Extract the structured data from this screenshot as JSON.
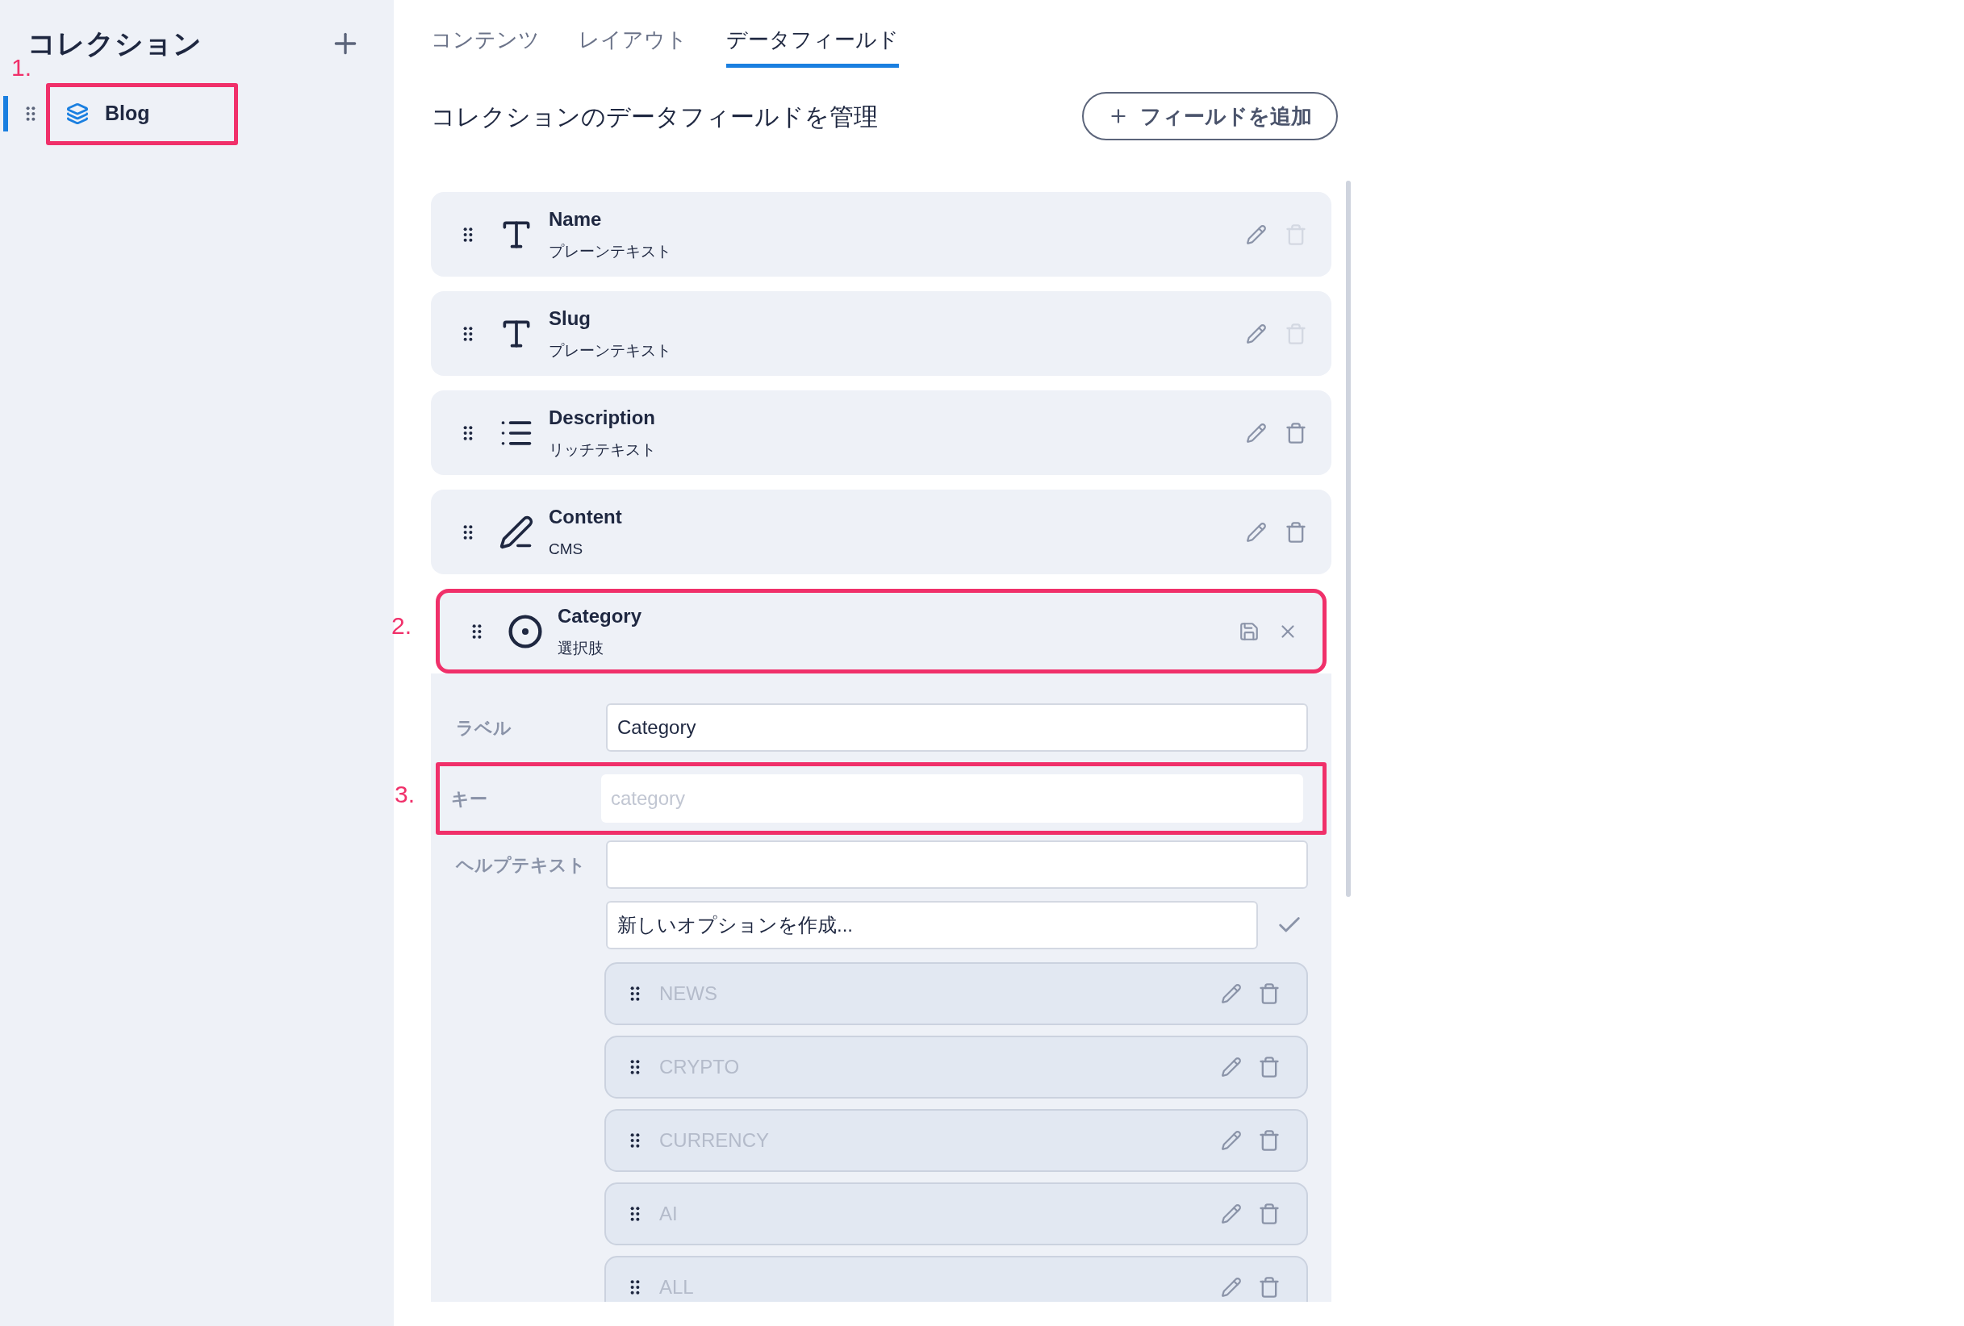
{
  "sidebar": {
    "title": "コレクション",
    "items": [
      {
        "label": "Blog",
        "selected": true,
        "annotation": "1."
      }
    ]
  },
  "tabs": [
    {
      "label": "コンテンツ",
      "selected": false
    },
    {
      "label": "レイアウト",
      "selected": false
    },
    {
      "label": "データフィールド",
      "selected": true
    }
  ],
  "heading": "コレクションのデータフィールドを管理",
  "add_button": "フィールドを追加",
  "fields": [
    {
      "name": "Name",
      "type": "プレーンテキスト",
      "kind": "text",
      "deletable": false,
      "editing": false
    },
    {
      "name": "Slug",
      "type": "プレーンテキスト",
      "kind": "text",
      "deletable": false,
      "editing": false
    },
    {
      "name": "Description",
      "type": "リッチテキスト",
      "kind": "rich_text",
      "deletable": true,
      "editing": false
    },
    {
      "name": "Content",
      "type": "CMS",
      "kind": "cms",
      "deletable": true,
      "editing": false
    },
    {
      "name": "Category",
      "type": "選択肢",
      "kind": "select",
      "editing": true,
      "annotation": "2."
    }
  ],
  "editor": {
    "rows": [
      {
        "label": "ラベル",
        "value": "Category",
        "disabled": false
      },
      {
        "label": "キー",
        "placeholder": "category",
        "disabled": true,
        "annotation": "3."
      },
      {
        "label": "ヘルプテキスト",
        "disabled": false
      }
    ],
    "new_option": {
      "value": "新しいオプションを作成..."
    },
    "options": [
      {
        "label": "NEWS"
      },
      {
        "label": "CRYPTO"
      },
      {
        "label": "CURRENCY"
      },
      {
        "label": "AI"
      },
      {
        "label": "ALL"
      }
    ]
  }
}
